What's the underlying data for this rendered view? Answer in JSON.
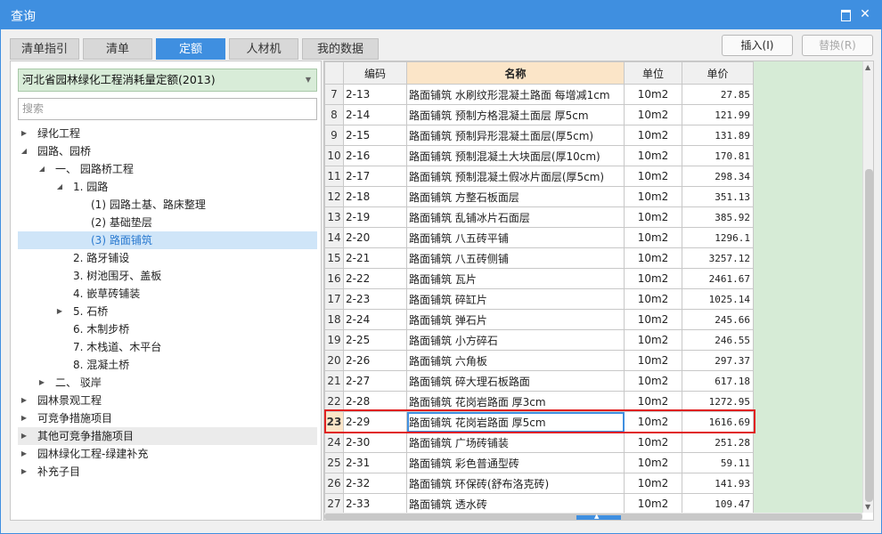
{
  "window": {
    "title": "查询",
    "max_icon": "maximize-icon",
    "close_icon": "close-icon",
    "close_glyph": "✕"
  },
  "tabs": [
    {
      "label": "清单指引",
      "active": false
    },
    {
      "label": "清单",
      "active": false
    },
    {
      "label": "定额",
      "active": true
    },
    {
      "label": "人材机",
      "active": false
    },
    {
      "label": "我的数据",
      "active": false
    }
  ],
  "actions": {
    "insert_label": "插入(I)",
    "replace_label": "替换(R)"
  },
  "left": {
    "quota_library": "河北省园林绿化工程消耗量定额(2013)",
    "search_placeholder": "搜索",
    "tree": [
      {
        "label": "绿化工程",
        "toggle": "▶"
      },
      {
        "label": "园路、园桥",
        "toggle": "◢"
      },
      {
        "label": "一、 园路桥工程",
        "toggle": "◢"
      },
      {
        "label": "1. 园路",
        "toggle": "◢"
      },
      {
        "label": "(1) 园路土基、路床整理",
        "toggle": ""
      },
      {
        "label": "(2) 基础垫层",
        "toggle": ""
      },
      {
        "label": "(3) 路面铺筑",
        "toggle": "",
        "selected": true
      },
      {
        "label": "2. 路牙铺设",
        "toggle": ""
      },
      {
        "label": "3. 树池围牙、盖板",
        "toggle": ""
      },
      {
        "label": "4. 嵌草砖铺装",
        "toggle": ""
      },
      {
        "label": "5. 石桥",
        "toggle": "▶"
      },
      {
        "label": "6. 木制步桥",
        "toggle": ""
      },
      {
        "label": "7. 木栈道、木平台",
        "toggle": ""
      },
      {
        "label": "8. 混凝土桥",
        "toggle": ""
      },
      {
        "label": "二、 驳岸",
        "toggle": "▶"
      },
      {
        "label": "园林景观工程",
        "toggle": "▶"
      },
      {
        "label": "可竞争措施项目",
        "toggle": "▶"
      },
      {
        "label": "其他可竞争措施项目",
        "toggle": "▶",
        "hover": true
      },
      {
        "label": "园林绿化工程-绿建补充",
        "toggle": "▶"
      },
      {
        "label": "补充子目",
        "toggle": "▶"
      }
    ]
  },
  "grid": {
    "headers": [
      "",
      "编码",
      "名称",
      "单位",
      "单价"
    ],
    "rows": [
      {
        "idx": "7",
        "code": "2-13",
        "name": "路面铺筑 水刷纹形混凝土路面 每增减1cm",
        "unit": "10m2",
        "price": "27.85"
      },
      {
        "idx": "8",
        "code": "2-14",
        "name": "路面铺筑 预制方格混凝土面层 厚5cm",
        "unit": "10m2",
        "price": "121.99"
      },
      {
        "idx": "9",
        "code": "2-15",
        "name": "路面铺筑 预制异形混凝土面层(厚5cm)",
        "unit": "10m2",
        "price": "131.89"
      },
      {
        "idx": "10",
        "code": "2-16",
        "name": "路面铺筑 预制混凝土大块面层(厚10cm)",
        "unit": "10m2",
        "price": "170.81"
      },
      {
        "idx": "11",
        "code": "2-17",
        "name": "路面铺筑 预制混凝土假冰片面层(厚5cm)",
        "unit": "10m2",
        "price": "298.34"
      },
      {
        "idx": "12",
        "code": "2-18",
        "name": "路面铺筑 方整石板面层",
        "unit": "10m2",
        "price": "351.13"
      },
      {
        "idx": "13",
        "code": "2-19",
        "name": "路面铺筑 乱铺冰片石面层",
        "unit": "10m2",
        "price": "385.92"
      },
      {
        "idx": "14",
        "code": "2-20",
        "name": "路面铺筑 八五砖平铺",
        "unit": "10m2",
        "price": "1296.1"
      },
      {
        "idx": "15",
        "code": "2-21",
        "name": "路面铺筑 八五砖侧铺",
        "unit": "10m2",
        "price": "3257.12"
      },
      {
        "idx": "16",
        "code": "2-22",
        "name": "路面铺筑 瓦片",
        "unit": "10m2",
        "price": "2461.67"
      },
      {
        "idx": "17",
        "code": "2-23",
        "name": "路面铺筑 碎缸片",
        "unit": "10m2",
        "price": "1025.14"
      },
      {
        "idx": "18",
        "code": "2-24",
        "name": "路面铺筑 弹石片",
        "unit": "10m2",
        "price": "245.66"
      },
      {
        "idx": "19",
        "code": "2-25",
        "name": "路面铺筑 小方碎石",
        "unit": "10m2",
        "price": "246.55"
      },
      {
        "idx": "20",
        "code": "2-26",
        "name": "路面铺筑 六角板",
        "unit": "10m2",
        "price": "297.37"
      },
      {
        "idx": "21",
        "code": "2-27",
        "name": "路面铺筑 碎大理石板路面",
        "unit": "10m2",
        "price": "617.18"
      },
      {
        "idx": "22",
        "code": "2-28",
        "name": "路面铺筑 花岗岩路面 厚3cm",
        "unit": "10m2",
        "price": "1272.95"
      },
      {
        "idx": "23",
        "code": "2-29",
        "name": "路面铺筑 花岗岩路面 厚5cm",
        "unit": "10m2",
        "price": "1616.69",
        "selected": true
      },
      {
        "idx": "24",
        "code": "2-30",
        "name": "路面铺筑 广场砖铺装",
        "unit": "10m2",
        "price": "251.28"
      },
      {
        "idx": "25",
        "code": "2-31",
        "name": "路面铺筑 彩色普通型砖",
        "unit": "10m2",
        "price": "59.11"
      },
      {
        "idx": "26",
        "code": "2-32",
        "name": "路面铺筑 环保砖(舒布洛克砖)",
        "unit": "10m2",
        "price": "141.93"
      },
      {
        "idx": "27",
        "code": "2-33",
        "name": "路面铺筑 透水砖",
        "unit": "10m2",
        "price": "109.47"
      }
    ]
  }
}
